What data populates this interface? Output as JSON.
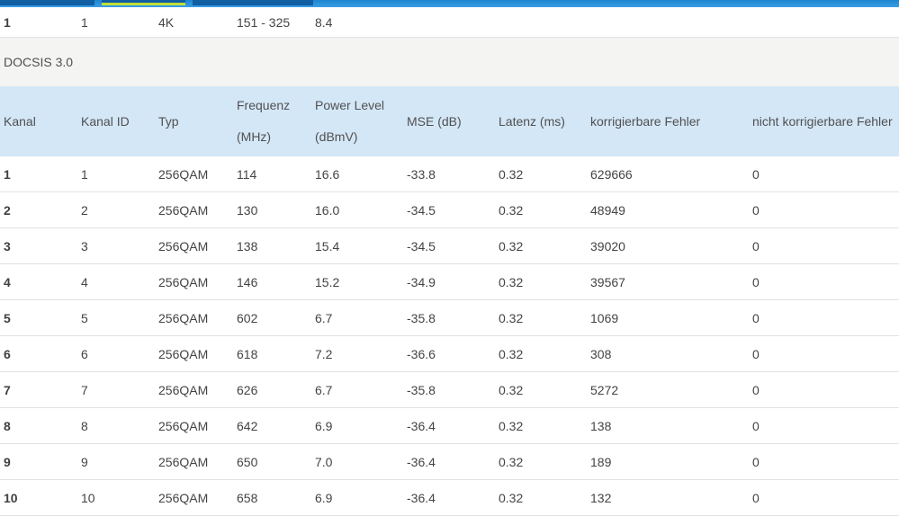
{
  "previous_table": {
    "last_row": [
      "1",
      "1",
      "4K",
      "151 - 325",
      "8.4"
    ]
  },
  "section": {
    "title": "DOCSIS 3.0"
  },
  "table": {
    "headers": {
      "kanal": "Kanal",
      "kanal_id": "Kanal ID",
      "typ": "Typ",
      "frequenz_line1": "Frequenz",
      "frequenz_line2": "(MHz)",
      "power_line1": "Power Level",
      "power_line2": "(dBmV)",
      "mse": "MSE (dB)",
      "latenz": "Latenz (ms)",
      "korrigierbar": "korrigierbare Fehler",
      "nicht_korrigierbar": "nicht korrigierbare Fehler"
    },
    "rows": [
      [
        "1",
        "1",
        "256QAM",
        "114",
        "16.6",
        "-33.8",
        "0.32",
        "629666",
        "0"
      ],
      [
        "2",
        "2",
        "256QAM",
        "130",
        "16.0",
        "-34.5",
        "0.32",
        "48949",
        "0"
      ],
      [
        "3",
        "3",
        "256QAM",
        "138",
        "15.4",
        "-34.5",
        "0.32",
        "39020",
        "0"
      ],
      [
        "4",
        "4",
        "256QAM",
        "146",
        "15.2",
        "-34.9",
        "0.32",
        "39567",
        "0"
      ],
      [
        "5",
        "5",
        "256QAM",
        "602",
        "6.7",
        "-35.8",
        "0.32",
        "1069",
        "0"
      ],
      [
        "6",
        "6",
        "256QAM",
        "618",
        "7.2",
        "-36.6",
        "0.32",
        "308",
        "0"
      ],
      [
        "7",
        "7",
        "256QAM",
        "626",
        "6.7",
        "-35.8",
        "0.32",
        "5272",
        "0"
      ],
      [
        "8",
        "8",
        "256QAM",
        "642",
        "6.9",
        "-36.4",
        "0.32",
        "138",
        "0"
      ],
      [
        "9",
        "9",
        "256QAM",
        "650",
        "7.0",
        "-36.4",
        "0.32",
        "189",
        "0"
      ],
      [
        "10",
        "10",
        "256QAM",
        "658",
        "6.9",
        "-36.4",
        "0.32",
        "132",
        "0"
      ]
    ]
  },
  "colors": {
    "nav": "#1f86d1",
    "nav_active_indicator": "#c3df3c",
    "header_bg": "#d4e7f7",
    "section_bg": "#f4f4f2"
  }
}
